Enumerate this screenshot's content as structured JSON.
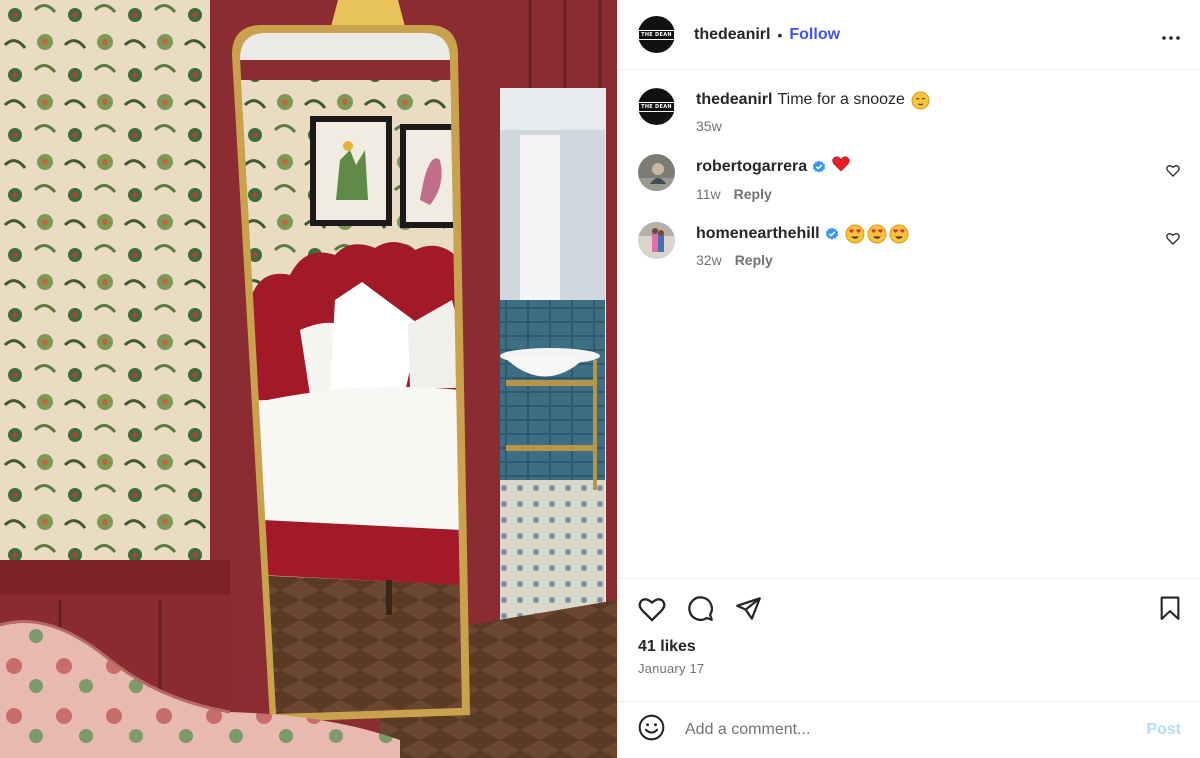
{
  "post": {
    "author": "thedeanirl",
    "avatar_text": "THE DEAN",
    "follow_label": "Follow",
    "separator": "•",
    "more_label": "•••",
    "image_alt": "Hotel room with red velvet bed reflected in a gold mirror"
  },
  "caption": {
    "username": "thedeanirl",
    "text": "Time for a snooze",
    "time": "35w"
  },
  "comments": [
    {
      "username": "robertogarrera",
      "verified": true,
      "time": "11w",
      "reply_label": "Reply"
    },
    {
      "username": "homenearthehill",
      "verified": true,
      "time": "32w",
      "reply_label": "Reply"
    }
  ],
  "stats": {
    "likes": "41 likes",
    "date": "January 17"
  },
  "add_comment": {
    "placeholder": "Add a comment...",
    "post_label": "Post"
  },
  "colors": {
    "follow": "#4150f7",
    "post_disabled": "#b2dffc",
    "verified": "#3897f0",
    "heart": "#ed1c24",
    "muted": "#737373"
  }
}
